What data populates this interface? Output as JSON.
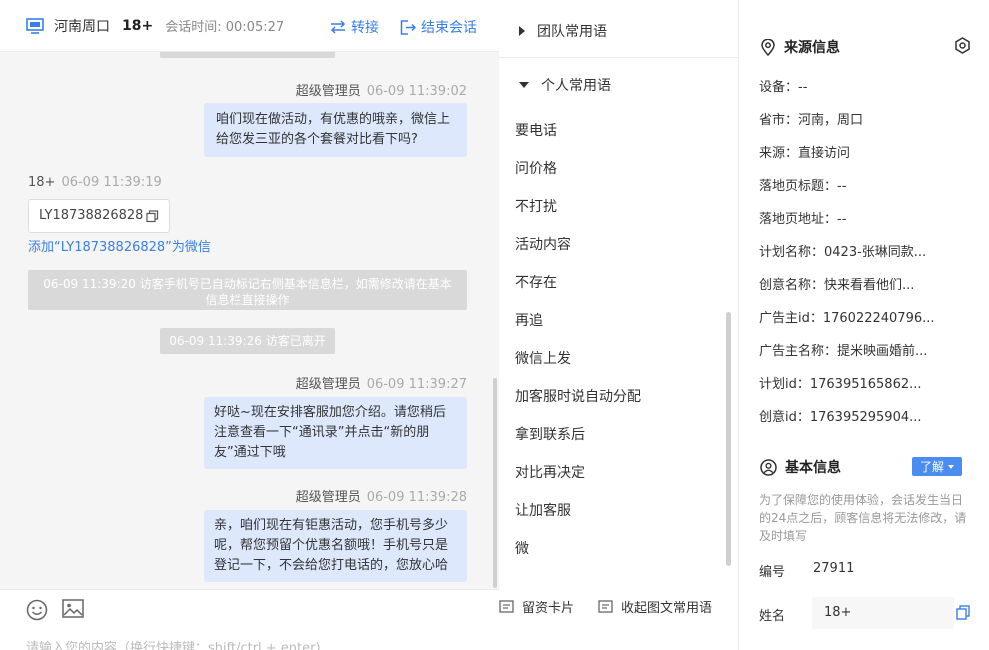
{
  "header": {
    "location": "河南周口",
    "visitor_nick": "18+",
    "session_label": "会话时间:",
    "session_time": "00:05:27",
    "transfer_label": "转接",
    "end_label": "结束会话"
  },
  "messages": {
    "m1_sender": "超级管理员",
    "m1_time": "06-09 11:39:02",
    "m1_text": "咱们现在做活动，有优惠的哦亲，微信上给您发三亚的各个套餐对比看下吗?",
    "m2_sender": "18+",
    "m2_time": "06-09 11:39:19",
    "m2_text": "LY18738826828",
    "add_wechat_link": "添加“LY18738826828”为微信",
    "sys1": "06-09 11:39:20 访客手机号已自动标记右侧基本信息栏，如需修改请在基本信息栏直接操作",
    "sys2": "06-09 11:39:26 访客已离开",
    "m3_sender": "超级管理员",
    "m3_time": "06-09 11:39:27",
    "m3_text": "好哒~现在安排客服加您介绍。请您稍后注意查看一下“通讯录”并点击“新的朋友”通过下哦",
    "m4_sender": "超级管理员",
    "m4_time": "06-09 11:39:28",
    "m4_text": "亲，咱们现在有钜惠活动，您手机号多少呢，帮您预留个优惠名额哦！手机号只是登记一下，不会给您打电话的，您放心哈"
  },
  "composer": {
    "placeholder": "请输入您的内容（换行快捷键：shift/ctrl + enter)",
    "emoji_icon": "emoji-icon",
    "image_icon": "image-icon"
  },
  "phrases": {
    "team_group": "团队常用语",
    "personal_group": "个人常用语",
    "items": [
      "要电话",
      "问价格",
      "不打扰",
      "活动内容",
      "不存在",
      "再追",
      "微信上发",
      "加客服时说自动分配",
      "拿到联系后",
      "对比再决定",
      "让加客服",
      "微"
    ],
    "card_label": "留资卡片",
    "collapse_label": "收起图文常用语"
  },
  "source_info": {
    "title": "来源信息",
    "device": "设备：--",
    "province_city": "省市：河南，周口",
    "source": "来源：直接访问",
    "landing_title": "落地页标题：--",
    "landing_url": "落地页地址：--",
    "plan_name": "计划名称：0423-张琳同款...",
    "creative_name": "创意名称：快来看看他们...",
    "advertiser_id": "广告主id：176022240796...",
    "advertiser_name": "广告主名称：提米映画婚前...",
    "plan_id": "计划id：176395165862...",
    "creative_id": "创意id：176395295904..."
  },
  "basic_info": {
    "title": "基本信息",
    "learn_label": "了解",
    "notice": "为了保障您的使用体验，会话发生当日的24点之后，顾客信息将无法修改，请及时填写",
    "id_label": "编号",
    "id_value": "27911",
    "name_label": "姓名",
    "name_value": "18+"
  },
  "colors": {
    "accent": "#3a7fe8",
    "bubble_right": "#dde8fd",
    "system_pill": "#d9d9d9",
    "chat_bg": "#f5f5f5"
  }
}
